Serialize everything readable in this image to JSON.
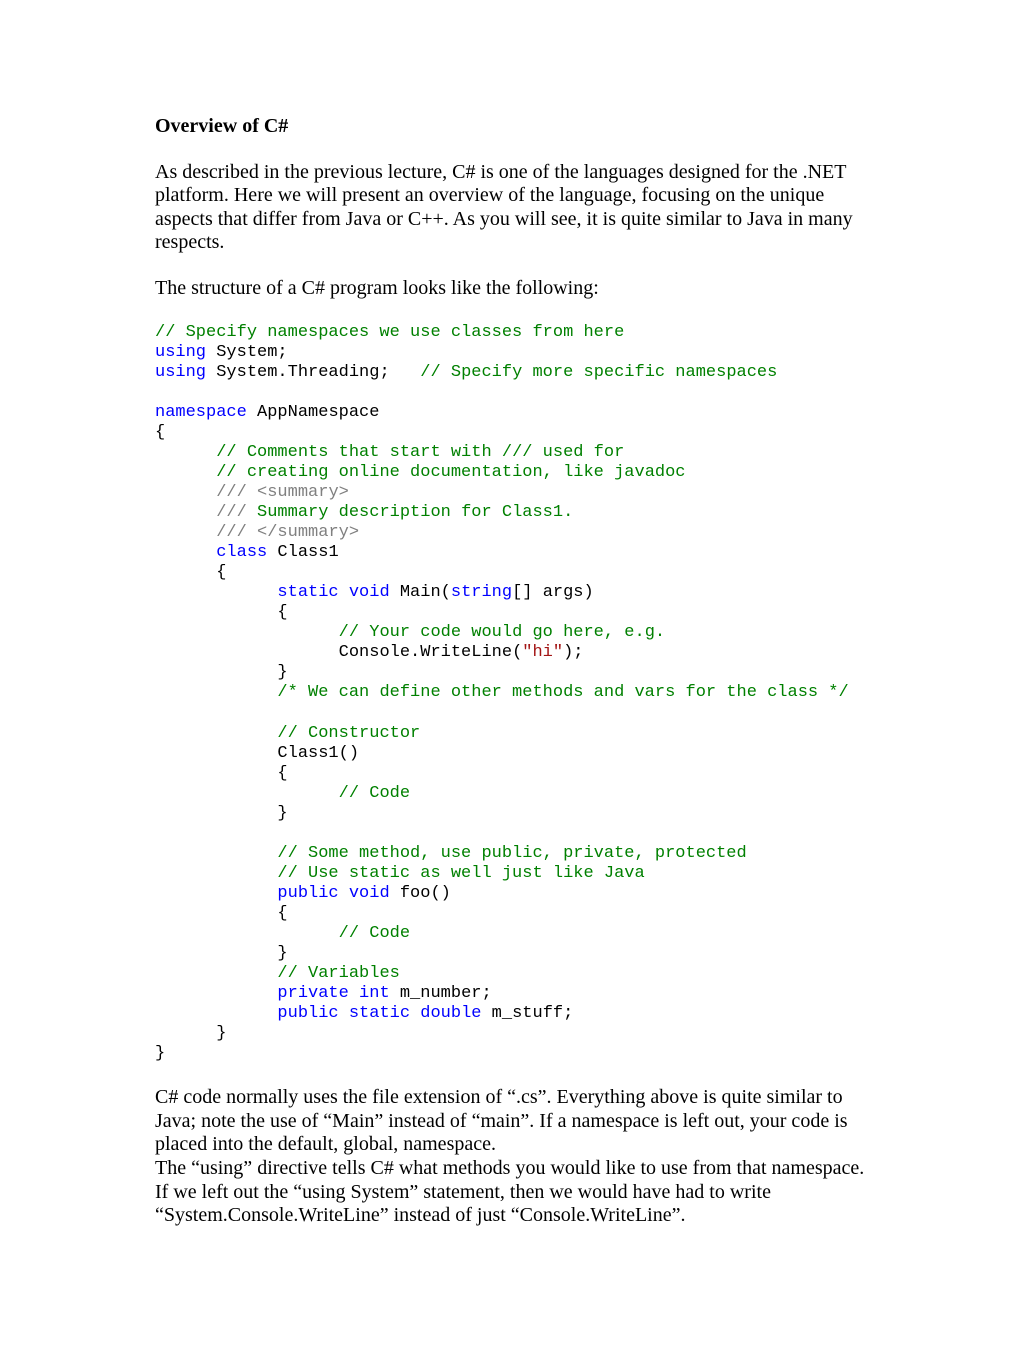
{
  "title": "Overview of C#",
  "p1": "As described in the previous lecture, C# is one of the languages designed for the .NET platform.  Here we will present an overview of the language, focusing on the unique aspects that differ from Java or C++.   As you will see, it is quite similar to Java in many respects.",
  "p2": "The structure of a C# program looks like the following:",
  "code": {
    "c1": "// Specify namespaces we use classes from here",
    "using": "using",
    "ns1": " System;",
    "ns2": " System.Threading;   ",
    "c2": "// Specify more specific namespaces",
    "namespace": "namespace",
    "nsname": " AppNamespace",
    "lb": "{",
    "rb": "}",
    "c3": "// Comments that start with /// used for",
    "c4": "// creating online documentation, like javadoc",
    "d1a": "///",
    "d1b": " <summary>",
    "d2a": "///",
    "d2b": " Summary description for Class1.",
    "d3a": "///",
    "d3b": " </summary>",
    "class": "class",
    "classname": " Class1",
    "static": "static",
    "void": "void",
    "mainsig1": " Main(",
    "string": "string",
    "mainsig2": "[] args)",
    "c5": "// Your code would go here, e.g.",
    "cw1": "Console.WriteLine(",
    "strlit": "\"hi\"",
    "cw2": ");",
    "c6": "/* We can define other methods and vars for the class */",
    "c7": "// Constructor",
    "ctor": "Class1()",
    "c8": "// Code",
    "c9": "// Some method, use public, private, protected",
    "c10": "// Use static as well just like Java",
    "public": "public",
    "foo": " foo()",
    "c11": "// Code",
    "c12": "// Variables",
    "private": "private",
    "int": "int",
    "mnum": " m_number;",
    "double": "double",
    "mstf": " m_stuff;"
  },
  "p3": "C# code normally uses the file extension of “.cs”.   Everything above is quite similar to Java; note the use of “Main” instead of “main”.   If a namespace is left out, your code is placed into the default, global, namespace.",
  "p4": "The “using” directive tells C# what methods you would like to use from that namespace.  If we left out the “using System” statement, then we would have had to write “System.Console.WriteLine” instead of just “Console.WriteLine”."
}
